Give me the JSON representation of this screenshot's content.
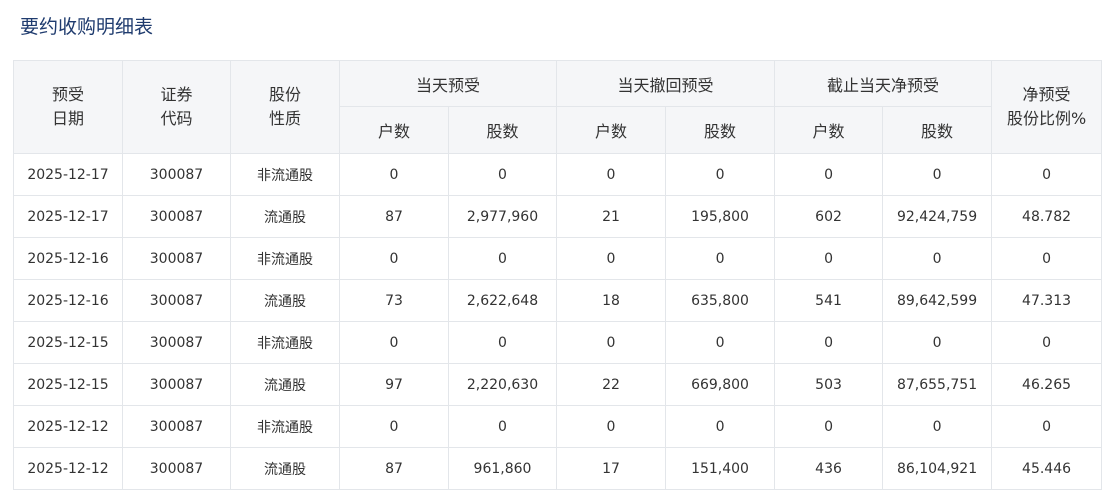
{
  "page": {
    "title": "要约收购明细表"
  },
  "table": {
    "headers": {
      "date": [
        "预受",
        "日期"
      ],
      "code": [
        "证券",
        "代码"
      ],
      "nature": [
        "股份",
        "性质"
      ],
      "group_today_accept": "当天预受",
      "group_today_withdraw": "当天撤回预受",
      "group_net": "截止当天净预受",
      "ratio": [
        "净预受",
        "股份比例%"
      ],
      "sub_households": "户数",
      "sub_shares": "股数"
    },
    "rows": [
      [
        "2025-12-17",
        "300087",
        "非流通股",
        "0",
        "0",
        "0",
        "0",
        "0",
        "0",
        "0"
      ],
      [
        "2025-12-17",
        "300087",
        "流通股",
        "87",
        "2,977,960",
        "21",
        "195,800",
        "602",
        "92,424,759",
        "48.782"
      ],
      [
        "2025-12-16",
        "300087",
        "非流通股",
        "0",
        "0",
        "0",
        "0",
        "0",
        "0",
        "0"
      ],
      [
        "2025-12-16",
        "300087",
        "流通股",
        "73",
        "2,622,648",
        "18",
        "635,800",
        "541",
        "89,642,599",
        "47.313"
      ],
      [
        "2025-12-15",
        "300087",
        "非流通股",
        "0",
        "0",
        "0",
        "0",
        "0",
        "0",
        "0"
      ],
      [
        "2025-12-15",
        "300087",
        "流通股",
        "97",
        "2,220,630",
        "22",
        "669,800",
        "503",
        "87,655,751",
        "46.265"
      ],
      [
        "2025-12-12",
        "300087",
        "非流通股",
        "0",
        "0",
        "0",
        "0",
        "0",
        "0",
        "0"
      ],
      [
        "2025-12-12",
        "300087",
        "流通股",
        "87",
        "961,860",
        "17",
        "151,400",
        "436",
        "86,104,921",
        "45.446"
      ]
    ]
  }
}
